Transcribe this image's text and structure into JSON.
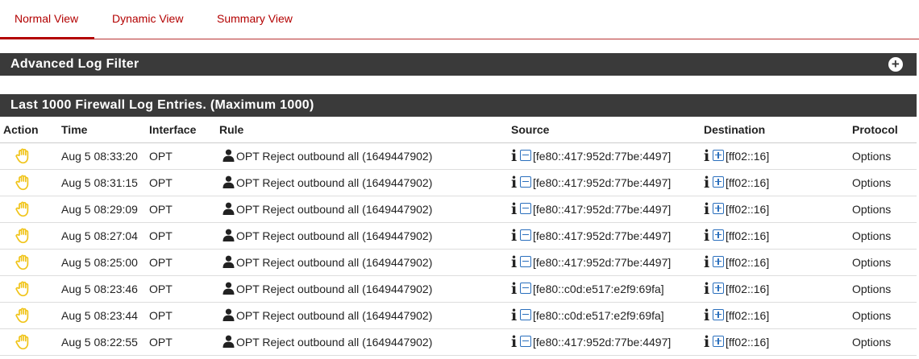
{
  "tabs": [
    {
      "label": "Normal View",
      "active": true
    },
    {
      "label": "Dynamic View",
      "active": false
    },
    {
      "label": "Summary View",
      "active": false
    }
  ],
  "filter_panel": {
    "title": "Advanced Log Filter",
    "icon": "plus-circle-icon"
  },
  "log_panel": {
    "title": "Last 1000 Firewall Log Entries. (Maximum 1000)"
  },
  "table": {
    "headers": [
      "Action",
      "Time",
      "Interface",
      "Rule",
      "Source",
      "Destination",
      "Protocol"
    ],
    "rows": [
      {
        "action_icon": "hand-reject-icon",
        "time": "Aug 5 08:33:20",
        "interface": "OPT",
        "rule": "OPT Reject outbound all (1649447902)",
        "source": "[fe80::417:952d:77be:4497]",
        "destination": "[ff02::16]",
        "protocol": "Options"
      },
      {
        "action_icon": "hand-reject-icon",
        "time": "Aug 5 08:31:15",
        "interface": "OPT",
        "rule": "OPT Reject outbound all (1649447902)",
        "source": "[fe80::417:952d:77be:4497]",
        "destination": "[ff02::16]",
        "protocol": "Options"
      },
      {
        "action_icon": "hand-reject-icon",
        "time": "Aug 5 08:29:09",
        "interface": "OPT",
        "rule": "OPT Reject outbound all (1649447902)",
        "source": "[fe80::417:952d:77be:4497]",
        "destination": "[ff02::16]",
        "protocol": "Options"
      },
      {
        "action_icon": "hand-reject-icon",
        "time": "Aug 5 08:27:04",
        "interface": "OPT",
        "rule": "OPT Reject outbound all (1649447902)",
        "source": "[fe80::417:952d:77be:4497]",
        "destination": "[ff02::16]",
        "protocol": "Options"
      },
      {
        "action_icon": "hand-reject-icon",
        "time": "Aug 5 08:25:00",
        "interface": "OPT",
        "rule": "OPT Reject outbound all (1649447902)",
        "source": "[fe80::417:952d:77be:4497]",
        "destination": "[ff02::16]",
        "protocol": "Options"
      },
      {
        "action_icon": "hand-reject-icon",
        "time": "Aug 5 08:23:46",
        "interface": "OPT",
        "rule": "OPT Reject outbound all (1649447902)",
        "source": "[fe80::c0d:e517:e2f9:69fa]",
        "destination": "[ff02::16]",
        "protocol": "Options"
      },
      {
        "action_icon": "hand-reject-icon",
        "time": "Aug 5 08:23:44",
        "interface": "OPT",
        "rule": "OPT Reject outbound all (1649447902)",
        "source": "[fe80::c0d:e517:e2f9:69fa]",
        "destination": "[ff02::16]",
        "protocol": "Options"
      },
      {
        "action_icon": "hand-reject-icon",
        "time": "Aug 5 08:22:55",
        "interface": "OPT",
        "rule": "OPT Reject outbound all (1649447902)",
        "source": "[fe80::417:952d:77be:4497]",
        "destination": "[ff02::16]",
        "protocol": "Options"
      }
    ]
  },
  "colors": {
    "accent": "#b30000",
    "panel_bar": "#3a3a3a",
    "hand_icon": "#f0c419",
    "link_icon": "#2a6fbd"
  }
}
